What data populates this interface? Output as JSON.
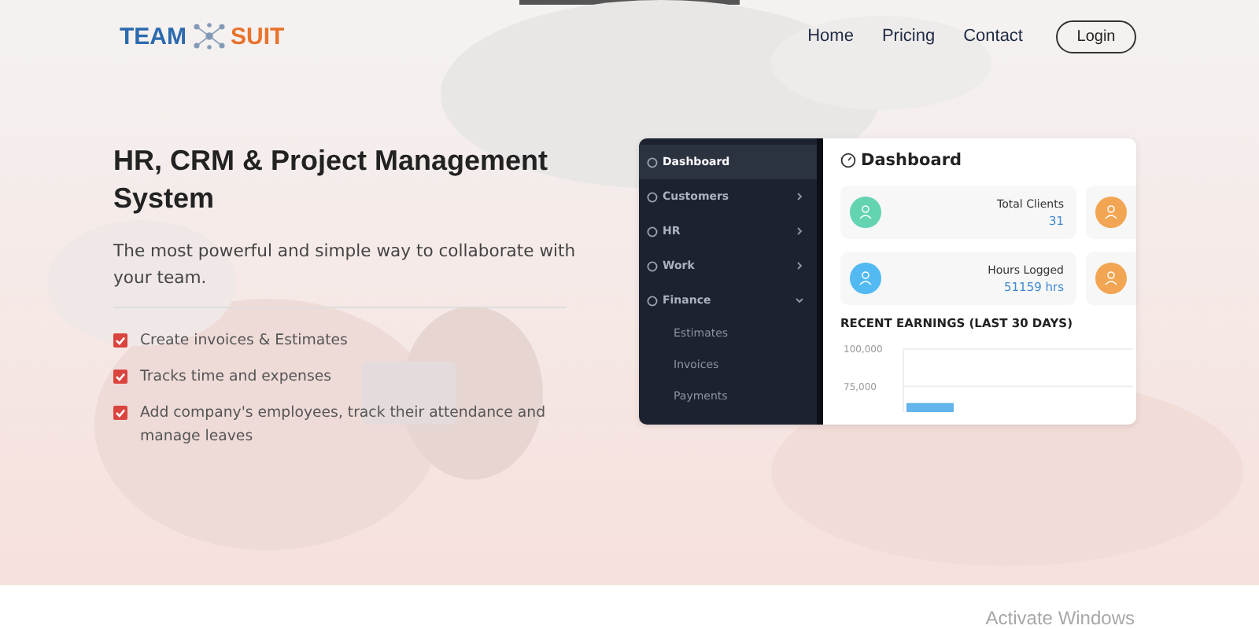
{
  "header": {
    "logo": {
      "left": "TEAM",
      "right": "SUIT"
    },
    "nav": [
      {
        "label": "Home"
      },
      {
        "label": "Pricing"
      },
      {
        "label": "Contact"
      }
    ],
    "login": "Login"
  },
  "hero": {
    "title": "HR, CRM & Project Management System",
    "subtitle": "The most powerful and simple way to collaborate with your team.",
    "features": [
      {
        "text": "Create invoices & Estimates",
        "checked": true
      },
      {
        "text": "Tracks time and expenses",
        "checked": true
      },
      {
        "text": "Add company's employees, track their attendance and manage leaves",
        "checked": true
      }
    ]
  },
  "dashboard": {
    "sidebar": [
      {
        "label": "Dashboard",
        "kind": "link",
        "selected": true
      },
      {
        "label": "Customers",
        "kind": "group",
        "selected": false,
        "expanded": false
      },
      {
        "label": "HR",
        "kind": "group",
        "selected": false,
        "expanded": false
      },
      {
        "label": "Work",
        "kind": "group",
        "selected": false,
        "expanded": false
      },
      {
        "label": "Finance",
        "kind": "group",
        "selected": false,
        "expanded": true,
        "children": [
          {
            "label": "Estimates"
          },
          {
            "label": "Invoices"
          },
          {
            "label": "Payments"
          }
        ]
      }
    ],
    "title": "Dashboard",
    "stats": [
      {
        "label": "Total Clients",
        "value": "31",
        "color": "#63d3b1"
      },
      {
        "color": "#f2a552"
      },
      {
        "label": "Hours Logged",
        "value": "51159 hrs",
        "color": "#52b9f2"
      },
      {
        "color": "#f2a552"
      }
    ],
    "earnings": {
      "title": "RECENT EARNINGS (LAST 30 DAYS)",
      "chart_data": {
        "type": "bar",
        "values": [
          64000
        ],
        "ylim": [
          58000,
          100000
        ],
        "yticks": [
          {
            "value": 75000,
            "label": "75,000"
          },
          {
            "value": 100000,
            "label": "100,000"
          }
        ]
      }
    }
  },
  "os_notice": "Activate Windows"
}
